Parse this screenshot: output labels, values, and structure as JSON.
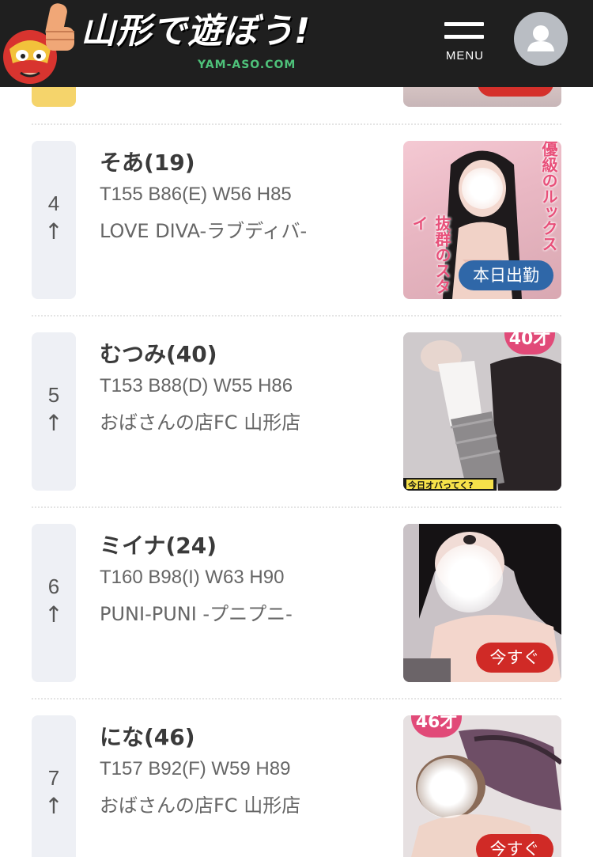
{
  "header": {
    "logo_title": "山形で遊ぼう!",
    "logo_sub": "YAM-ASO.COM",
    "menu_label": "MENU"
  },
  "ranking": [
    {
      "rank": "4",
      "arrow": "↑",
      "name": "そあ(19)",
      "specs": "T155 B86(E) W56 H85",
      "shop": "LOVE DIVA-ラブディバ-",
      "badge": "本日出勤",
      "badge_color": "#2f67a8",
      "photo_text_1": "優級のルックス",
      "photo_text_2": "抜群のスタイ"
    },
    {
      "rank": "5",
      "arrow": "↑",
      "name": "むつみ(40)",
      "specs": "T153 B88(D) W55 H86",
      "shop": "おばさんの店FC 山形店",
      "photo_age": "40才",
      "photo_caption": "今日オバってく?"
    },
    {
      "rank": "6",
      "arrow": "↑",
      "name": "ミイナ(24)",
      "specs": "T160 B98(I) W63 H90",
      "shop": "PUNI-PUNI -プニプニ-",
      "badge": "今すぐ",
      "badge_color": "#d02a26"
    },
    {
      "rank": "7",
      "arrow": "↑",
      "name": "にな(46)",
      "specs": "T157 B92(F) W59 H89",
      "shop": "おばさんの店FC 山形店",
      "photo_age": "46才",
      "badge": "今すぐ",
      "badge_color": "#d02a26"
    }
  ],
  "colors": {
    "header_bg": "#1f1f1f",
    "rank_box_bg": "#eef0f5",
    "top_rank_bg": "#f5d46b",
    "logo_sub": "#4ec27a"
  }
}
